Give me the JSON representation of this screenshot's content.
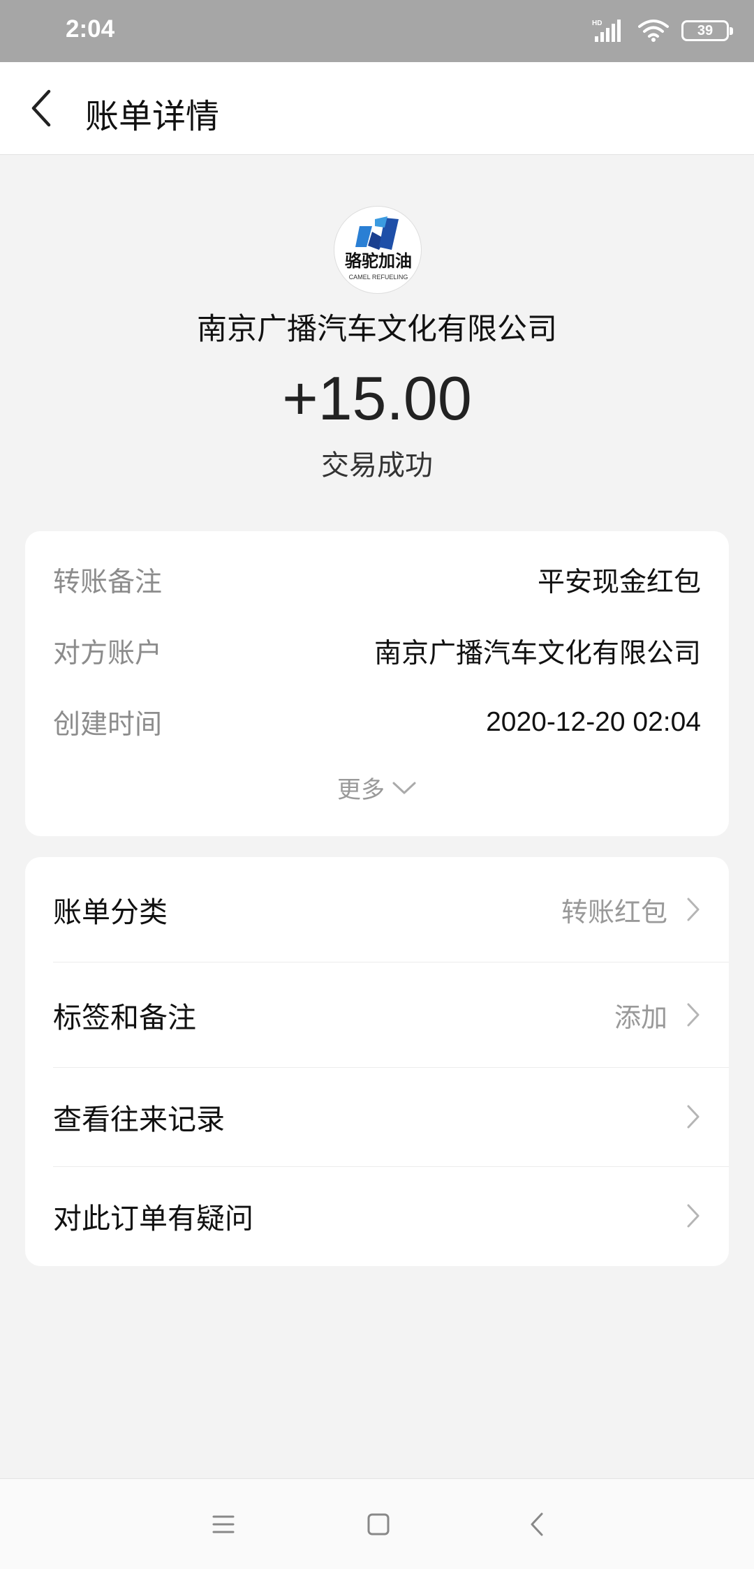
{
  "status_bar": {
    "time": "2:04",
    "battery": "39",
    "network": "HD"
  },
  "header": {
    "title": "账单详情"
  },
  "merchant": {
    "logo_text": "骆驼加油",
    "logo_subtext": "CAMEL REFUELING",
    "name": "南京广播汽车文化有限公司",
    "amount": "+15.00",
    "status": "交易成功"
  },
  "details": {
    "rows": [
      {
        "label": "转账备注",
        "value": "平安现金红包"
      },
      {
        "label": "对方账户",
        "value": "南京广播汽车文化有限公司"
      },
      {
        "label": "创建时间",
        "value": "2020-12-20 02:04"
      }
    ],
    "more_label": "更多"
  },
  "menu": {
    "items": [
      {
        "label": "账单分类",
        "value": "转账红包"
      },
      {
        "label": "标签和备注",
        "value": "添加"
      },
      {
        "label": "查看往来记录",
        "value": ""
      },
      {
        "label": "对此订单有疑问",
        "value": ""
      }
    ]
  },
  "icons": {
    "back": "chevron-left-icon",
    "more": "chevron-down-icon",
    "row_arrow": "chevron-right-icon",
    "nav_menu": "menu-icon",
    "nav_home": "home-square-icon",
    "nav_back": "back-triangle-icon"
  },
  "colors": {
    "status_bar": "#a6a6a6",
    "background": "#f3f3f3",
    "logo_blue": "#1e4fa8"
  }
}
